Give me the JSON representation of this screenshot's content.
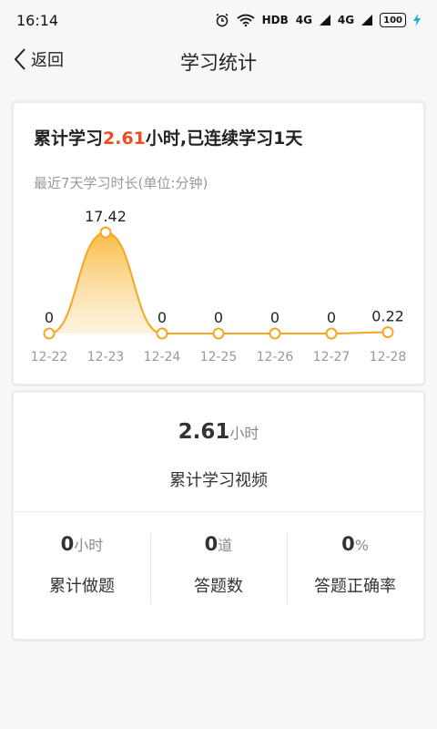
{
  "status_bar": {
    "time": "16:14",
    "alarm_icon": "alarm-icon",
    "wifi_icon": "wifi-icon",
    "network_label": "HDB",
    "signal1": "4G",
    "signal2": "4G",
    "battery": "100"
  },
  "nav": {
    "back_label": "返回",
    "title": "学习统计"
  },
  "summary": {
    "prefix": "累计学习",
    "hours": "2.61",
    "middle": "小时,已连续学习",
    "days": "1天"
  },
  "chart_label": "最近7天学习时长(单位:分钟)",
  "chart_data": {
    "type": "area",
    "categories": [
      "12-22",
      "12-23",
      "12-24",
      "12-25",
      "12-26",
      "12-27",
      "12-28"
    ],
    "values": [
      0,
      17.42,
      0,
      0,
      0,
      0,
      0.22
    ],
    "value_labels": [
      "0",
      "17.42",
      "0",
      "0",
      "0",
      "0",
      "0.22"
    ],
    "ylim": [
      0,
      17.42
    ],
    "line_color": "#f5a623",
    "fill_color": "#fbd38a"
  },
  "video": {
    "value": "2.61",
    "unit": "小时",
    "label": "累计学习视频"
  },
  "stats": [
    {
      "value": "0",
      "unit": "小时",
      "label": "累计做题"
    },
    {
      "value": "0",
      "unit": "道",
      "label": "答题数"
    },
    {
      "value": "0",
      "unit": "%",
      "label": "答题正确率"
    }
  ]
}
